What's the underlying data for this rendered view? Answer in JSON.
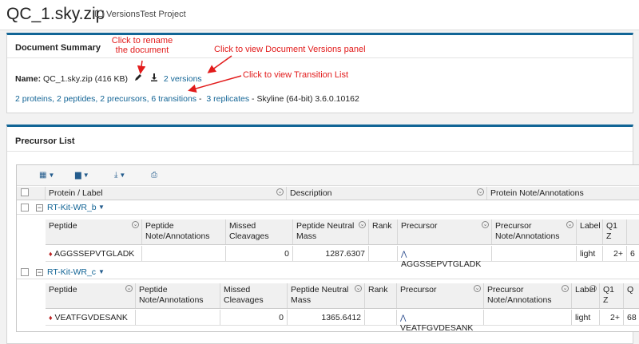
{
  "header": {
    "title": "QC_1.sky.zip",
    "project": "VersionsTest Project"
  },
  "summary": {
    "title": "Document Summary",
    "name_label": "Name:",
    "name_value": "QC_1.sky.zip (416 KB)",
    "versions_link": "2 versions",
    "stats_link": "2 proteins, 2 peptides, 2 precursors, 6 transitions",
    "dash1": "-",
    "replicates_link": "3 replicates",
    "dash2": "-",
    "software": "Skyline (64-bit) 3.6.0.10162"
  },
  "annotations": {
    "rename_line1": "Click to rename",
    "rename_line2": "the document",
    "versions": "Click to view Document Versions panel",
    "transitions": "Click to view Transition List"
  },
  "precursor_list": {
    "title": "Precursor List",
    "columns": [
      "Protein / Label",
      "Description",
      "Protein Note/Annotations"
    ],
    "peptide_columns": [
      "Peptide",
      "Peptide Note/Annotations",
      "Missed Cleavages",
      "Peptide Neutral Mass",
      "Rank",
      "Precursor",
      "Precursor Note/Annotations",
      "Label",
      "Q1 Z",
      "Q"
    ],
    "groups": [
      {
        "protein": "RT-Kit-WR_b",
        "peptide": "AGGSSEPVTGLADK",
        "missed": "0",
        "mass": "1287.6307",
        "precursor": "AGGSSEPVTGLADK",
        "label": "light",
        "charge": "2+",
        "q": "6"
      },
      {
        "protein": "RT-Kit-WR_c",
        "peptide": "VEATFGVDESANK",
        "missed": "0",
        "mass": "1365.6412",
        "precursor": "VEATFGVDESANK",
        "label": "light",
        "charge": "2+",
        "q": "68"
      }
    ]
  },
  "colors": {
    "accent": "#116596",
    "annotation": "#e21b1b",
    "link": "#126495"
  }
}
